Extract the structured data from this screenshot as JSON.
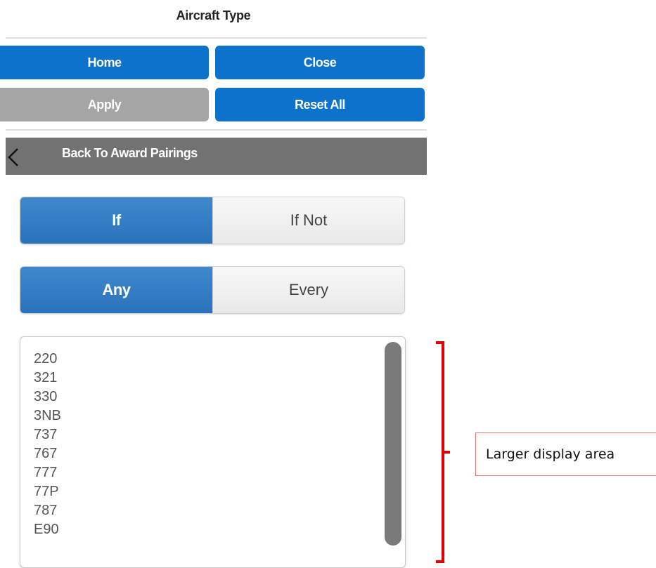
{
  "header": {
    "title": "Aircraft Type"
  },
  "buttons": {
    "home": "Home",
    "close": "Close",
    "apply": "Apply",
    "reset_all": "Reset All"
  },
  "back_bar": {
    "label": "Back To Award Pairings",
    "icon": "chevron-left-icon"
  },
  "condition_toggle": {
    "options": [
      "If",
      "If Not"
    ],
    "selected": "If"
  },
  "match_toggle": {
    "options": [
      "Any",
      "Every"
    ],
    "selected": "Any"
  },
  "aircraft_list": {
    "items": [
      "220",
      "321",
      "330",
      "3NB",
      "737",
      "767",
      "777",
      "77P",
      "787",
      "E90"
    ]
  },
  "annotation": {
    "label": "Larger display area",
    "color": "#e00000"
  },
  "colors": {
    "primary_button": "#0c72cc",
    "disabled_button": "#a5a5a5",
    "back_bar": "#727272",
    "segment_active": "#2f7bc3"
  }
}
